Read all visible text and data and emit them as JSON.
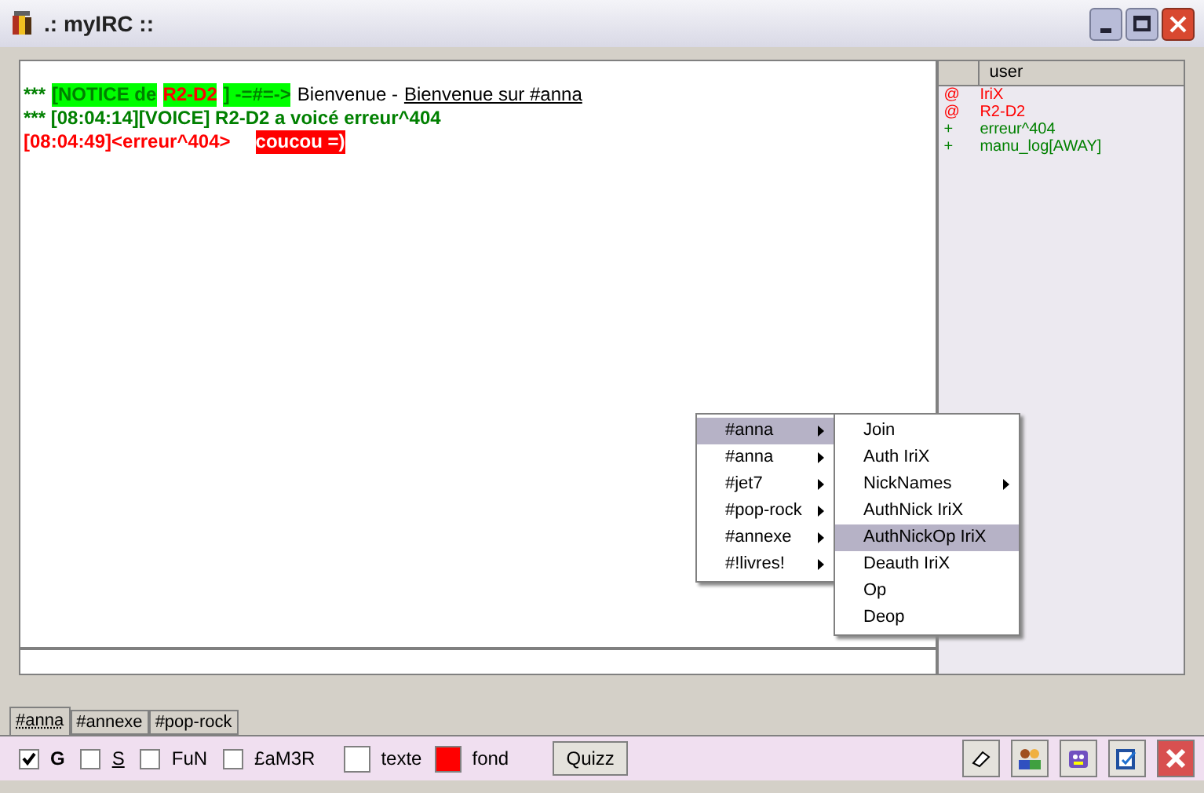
{
  "window": {
    "title": ".: myIRC ::"
  },
  "chat": {
    "lines": [
      {
        "segments": [
          {
            "text": "***",
            "color": "#008000",
            "kind": "plain"
          },
          {
            "text": "[NOTICE de",
            "kind": "notice"
          },
          {
            "text": "R2-D2",
            "kind": "notice-nick"
          },
          {
            "text": "] -=#=->",
            "kind": "notice"
          },
          {
            "text": "Bienvenue -",
            "color": "#000000",
            "kind": "plain"
          },
          {
            "text": "Bienvenue sur #anna",
            "color": "#000000",
            "kind": "link"
          }
        ]
      },
      {
        "segments": [
          {
            "text": "*** [08:04:14][VOICE] R2-D2 a voicé erreur^404",
            "color": "#008000",
            "kind": "plain"
          }
        ]
      },
      {
        "segments": [
          {
            "text": "[08:04:49]<erreur^404>",
            "color": "#ff0000",
            "kind": "plain"
          },
          {
            "text": "coucou =)",
            "kind": "alert"
          }
        ]
      }
    ]
  },
  "user_list": {
    "column_header": "user",
    "users": [
      {
        "prefix": "@",
        "name": "IriX",
        "color": "#ff0000"
      },
      {
        "prefix": "@",
        "name": "R2-D2",
        "color": "#ff0000"
      },
      {
        "prefix": "+",
        "name": "erreur^404",
        "color": "#008000"
      },
      {
        "prefix": "+",
        "name": "manu_log[AWAY]",
        "color": "#008000"
      }
    ]
  },
  "context_menu": {
    "items": [
      {
        "label": "#anna",
        "selected": true
      },
      {
        "label": "#anna",
        "selected": false
      },
      {
        "label": "#jet7",
        "selected": false
      },
      {
        "label": "#pop-rock",
        "selected": false
      },
      {
        "label": "#annexe",
        "selected": false
      },
      {
        "label": "#!livres!",
        "selected": false
      }
    ]
  },
  "submenu": {
    "items": [
      {
        "label": "Join",
        "selected": false,
        "has_submenu": false
      },
      {
        "label": "Auth IriX",
        "selected": false,
        "has_submenu": false
      },
      {
        "label": "NickNames",
        "selected": false,
        "has_submenu": true
      },
      {
        "label": "AuthNick IriX",
        "selected": false,
        "has_submenu": false
      },
      {
        "label": "AuthNickOp IriX",
        "selected": true,
        "has_submenu": false
      },
      {
        "label": "Deauth IriX",
        "selected": false,
        "has_submenu": false
      },
      {
        "label": "Op",
        "selected": false,
        "has_submenu": false
      },
      {
        "label": "Deop",
        "selected": false,
        "has_submenu": false
      }
    ]
  },
  "tabs": [
    {
      "label": "#anna",
      "selected": true
    },
    {
      "label": "#annexe",
      "selected": false
    },
    {
      "label": "#pop-rock",
      "selected": false
    }
  ],
  "toolbar": {
    "options": [
      {
        "label": "G",
        "checked": true,
        "kind": "bold"
      },
      {
        "label": "S",
        "checked": false,
        "kind": "underline"
      },
      {
        "label": "FuN",
        "checked": false,
        "kind": "plain"
      },
      {
        "label": "£aM3R",
        "checked": false,
        "kind": "plain"
      }
    ],
    "swatches": [
      {
        "label": "texte",
        "color": "#ffffff"
      },
      {
        "label": "fond",
        "color": "#ff0000"
      }
    ],
    "quiz_button": "Quizz"
  }
}
